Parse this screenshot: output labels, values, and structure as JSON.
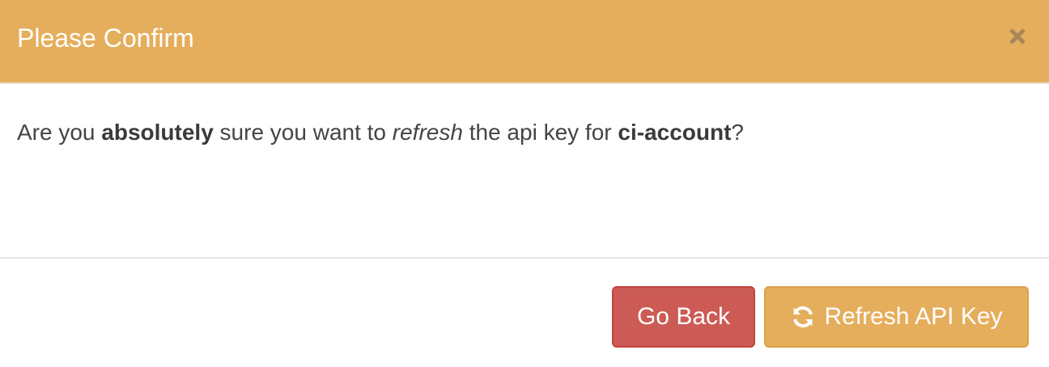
{
  "dialog": {
    "title": "Please Confirm",
    "close_icon": "close-icon",
    "header_color": "#e5ae5c",
    "message": {
      "prefix": "Are you ",
      "emphasis_bold": "absolutely",
      "middle": " sure you want to ",
      "emphasis_italic": "refresh",
      "middle2": " the api key for ",
      "account": "ci-account",
      "suffix": "?"
    },
    "buttons": {
      "back_label": "Go Back",
      "back_color": "#cc5b55",
      "refresh_label": "Refresh API Key",
      "refresh_icon": "refresh-icon",
      "refresh_color": "#e5ae5c"
    }
  }
}
